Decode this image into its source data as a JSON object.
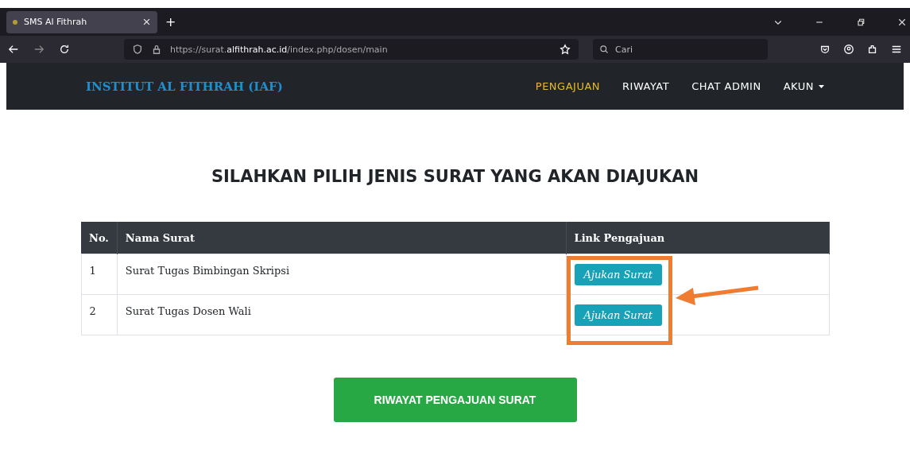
{
  "browser": {
    "tab_title": "SMS Al Fithrah",
    "new_tab": "+",
    "url_prefix": "https://surat.",
    "url_domain": "alfithrah.ac.id",
    "url_path": "/index.php/dosen/main",
    "search_placeholder": "Cari"
  },
  "navbar": {
    "brand": "INSTITUT AL FITHRAH (IAF)",
    "items": [
      {
        "label": "PENGAJUAN",
        "selected": true,
        "dropdown": false
      },
      {
        "label": "RIWAYAT",
        "selected": false,
        "dropdown": false
      },
      {
        "label": "CHAT ADMIN",
        "selected": false,
        "dropdown": false
      },
      {
        "label": "AKUN",
        "selected": false,
        "dropdown": true
      }
    ]
  },
  "heading": "SILAHKAN PILIH JENIS SURAT YANG AKAN DIAJUKAN",
  "table": {
    "columns": [
      "No.",
      "Nama Surat",
      "Link Pengajuan"
    ],
    "rows": [
      {
        "no": "1",
        "name": "Surat Tugas Bimbingan Skripsi",
        "action": "Ajukan Surat"
      },
      {
        "no": "2",
        "name": "Surat Tugas Dosen Wali",
        "action": "Ajukan Surat"
      }
    ]
  },
  "history_button": "RIWAYAT PENGAJUAN SURAT"
}
